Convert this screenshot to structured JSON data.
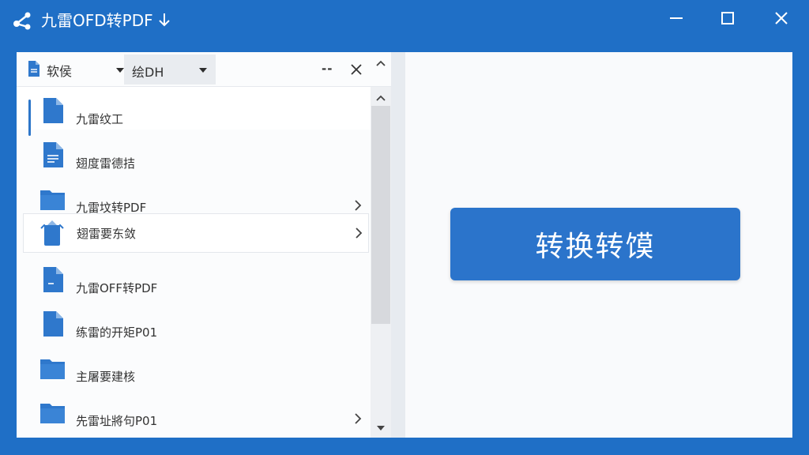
{
  "window": {
    "title": "九雷OFD转PDF",
    "icons": {
      "app": "share-nodes-icon",
      "download": "download-arrow-icon"
    },
    "controls": {
      "minimize": "minimize-icon",
      "maximize": "maximize-icon",
      "close": "close-icon"
    }
  },
  "toolbar": {
    "file_dropdown_label": "软侯",
    "type_dropdown_label": "绘DH",
    "dash_label": "--"
  },
  "list": {
    "items": [
      {
        "label": "九雷纹工",
        "icon": "document-icon",
        "selected": true,
        "has_chevron": false
      },
      {
        "label": "翅度雷德拮",
        "icon": "text-document-icon",
        "selected": false,
        "has_chevron": false
      },
      {
        "label": "九雷坟转PDF",
        "icon": "folder-icon",
        "selected": false,
        "has_chevron": true
      },
      {
        "label": "翅雷要东敛",
        "icon": "open-box-icon",
        "selected": false,
        "has_chevron": true
      },
      {
        "label": "九雷OFF转PDF",
        "icon": "document-minus-icon",
        "selected": false,
        "has_chevron": false
      },
      {
        "label": "练雷的开矩P01",
        "icon": "document-icon",
        "selected": false,
        "has_chevron": false
      },
      {
        "label": "主屠要建核",
        "icon": "folder-icon",
        "selected": false,
        "has_chevron": false
      },
      {
        "label": "先雷址將句P01",
        "icon": "folder-icon",
        "selected": false,
        "has_chevron": true
      }
    ]
  },
  "main": {
    "convert_button_label": "转换转馍"
  },
  "colors": {
    "accent": "#2b74cb",
    "window_frame": "#1f6fc6",
    "icon_blue": "#2f78cc"
  }
}
